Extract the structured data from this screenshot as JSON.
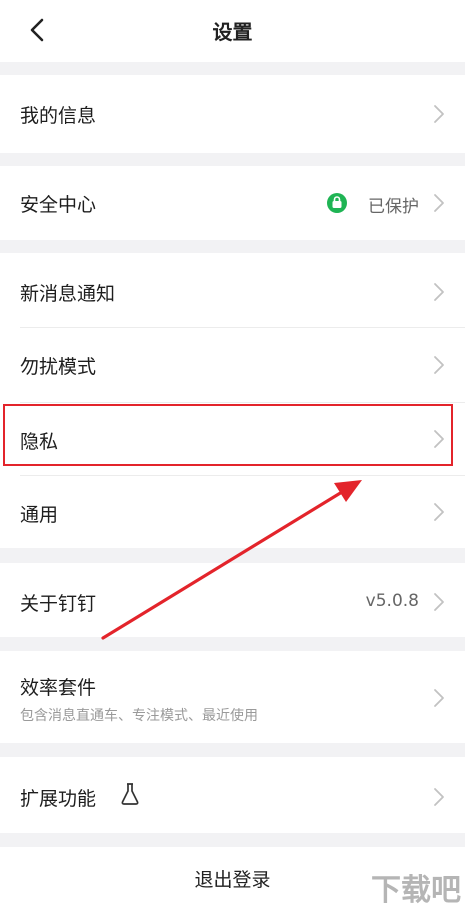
{
  "header": {
    "title": "设置",
    "back_icon": "chevron-left-icon"
  },
  "items": {
    "my_info": {
      "label": "我的信息"
    },
    "security": {
      "label": "安全中心",
      "status": "已保护",
      "status_color": "#1fb454"
    },
    "notifications": {
      "label": "新消息通知"
    },
    "dnd": {
      "label": "勿扰模式"
    },
    "privacy": {
      "label": "隐私"
    },
    "general": {
      "label": "通用"
    },
    "about": {
      "label": "关于钉钉",
      "version": "v5.0.8"
    },
    "efficiency": {
      "label": "效率套件",
      "subtitle": "包含消息直通车、专注模式、最近使用"
    },
    "extensions": {
      "label": "扩展功能",
      "icon": "flask-icon"
    }
  },
  "logout": {
    "label": "退出登录"
  },
  "annotation": {
    "highlight_color": "#e3242b"
  },
  "watermark": {
    "text": "下载吧"
  }
}
